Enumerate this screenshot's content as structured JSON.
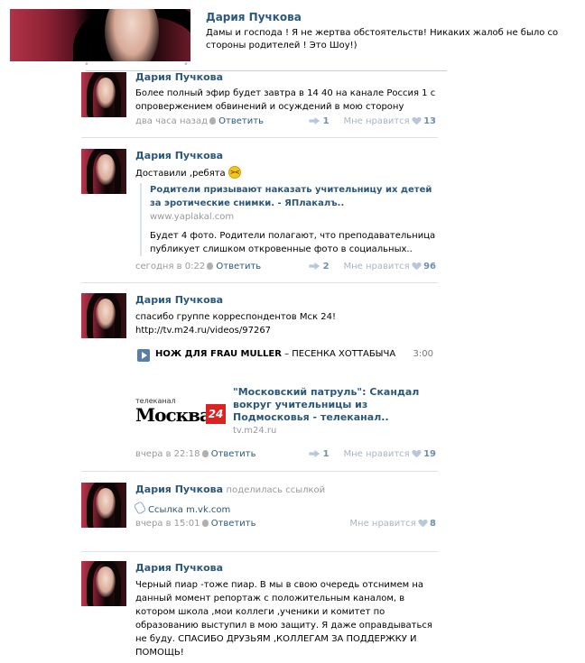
{
  "top": {
    "author": "Дария Пучкова",
    "text": "Дамы и господа ! Я не жертва обстоятельств! Никаких жалоб не было со стороны родителей ! Это Шоу!)"
  },
  "posts": [
    {
      "author": "Дария Пучкова",
      "text": "Более полный эфир будет завтра в 14 40 на канале Россия 1 с опровержением обвинений и осуждений в мою сторону",
      "time": "два часа назад",
      "reply": "Ответить",
      "shares": "1",
      "likes_label": "Мне нравится",
      "likes": "13"
    },
    {
      "author": "Дария Пучкова",
      "text": "Доставили ,ребята",
      "link_title": "Родители призывают наказать учительницу их детей за эротические снимки. - ЯПлакалъ..",
      "link_site": "www.yaplakal.com",
      "link_desc": "Будет 4 фото. Родители полагают, что преподавательница публикует слишком откровенные фото в социальных..",
      "time": "сегодня в 0:22",
      "reply": "Ответить",
      "shares": "2",
      "likes_label": "Мне нравится",
      "likes": "96"
    },
    {
      "author": "Дария Пучкова",
      "text": "спасибо группе корреспондентов Мск 24!",
      "url": "http://tv.m24.ru/videos/97267",
      "audio_artist": "НОЖ ДЛЯ FRAU MULLER",
      "audio_dash": " – ",
      "audio_title": "ПЕСЕНКА ХОТТАБЫЧА",
      "audio_duration": "3:00",
      "logo_small": "телеканал",
      "logo_word": "Москва",
      "logo_num": "24",
      "card_title": "\"Московский патруль\": Скандал вокруг учительницы из Подмосковья - телеканал..",
      "card_site": "tv.m24.ru",
      "time": "вчера в 22:18",
      "reply": "Ответить",
      "shares": "1",
      "likes_label": "Мне нравится",
      "likes": "19"
    },
    {
      "author": "Дария Пучкова",
      "action": "поделилась ссылкой",
      "share_label": "Ссылка m.vk.com",
      "time": "вчера в 15:01",
      "reply": "Ответить",
      "likes_label": "Мне нравится",
      "likes": "8"
    },
    {
      "author": "Дария Пучкова",
      "text": "Черный пиар -тоже пиар. В мы в свою очередь отснимем на данный момент репортаж с положительным каналом, в котором школа ,мои коллеги ,ученики и комитет по образованию выступил в мою защиту. Я даже оправдываться не буду. СПАСИБО ДРУЗЬЯМ ,КОЛЛЕГАМ ЗА ПОДДЕРЖКУ И ПОМОЩЬ!"
    }
  ]
}
